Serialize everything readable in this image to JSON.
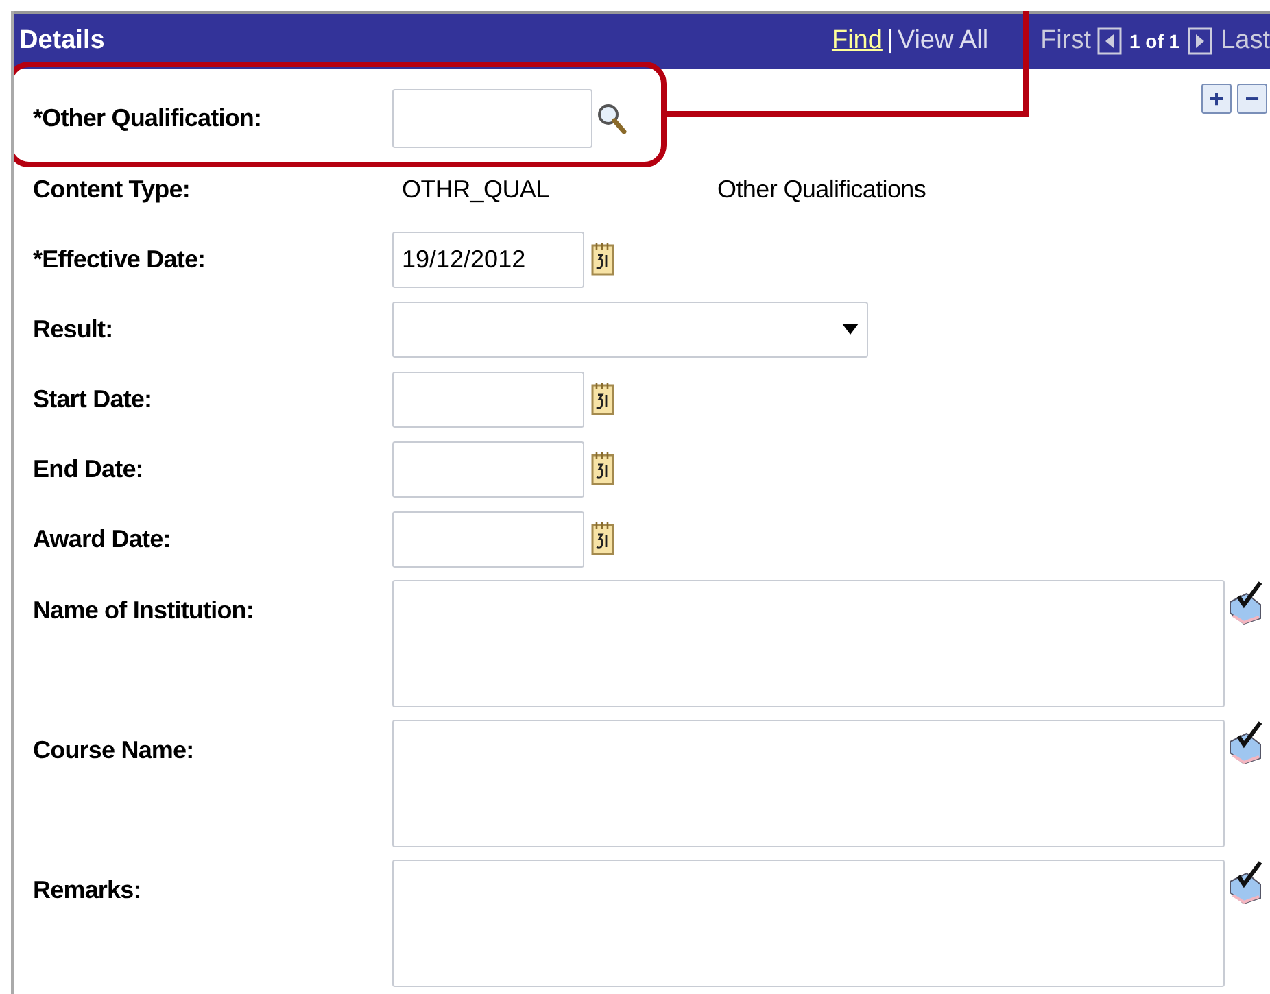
{
  "header": {
    "title": "Details",
    "find": "Find",
    "separator": "|",
    "view_all": "View All",
    "first": "First",
    "page": "1 of 1",
    "last": "Last"
  },
  "row_buttons": [
    "+",
    "−"
  ],
  "fields": [
    {
      "kind": "lookup",
      "label": "*Other Qualification:"
    },
    {
      "kind": "display",
      "label": "Content Type:",
      "value": "OTHR_QUAL",
      "description": "Other Qualifications"
    },
    {
      "kind": "date",
      "label": "*Effective Date:",
      "value": "19/12/2012"
    },
    {
      "kind": "select",
      "label": "Result:"
    },
    {
      "kind": "date",
      "label": "Start Date:"
    },
    {
      "kind": "date",
      "label": "End Date:"
    },
    {
      "kind": "date",
      "label": "Award Date:"
    },
    {
      "kind": "longtext",
      "label": "Name of Institution:"
    },
    {
      "kind": "longtext",
      "label": "Course Name:"
    },
    {
      "kind": "longtext",
      "label": "Remarks:"
    }
  ]
}
